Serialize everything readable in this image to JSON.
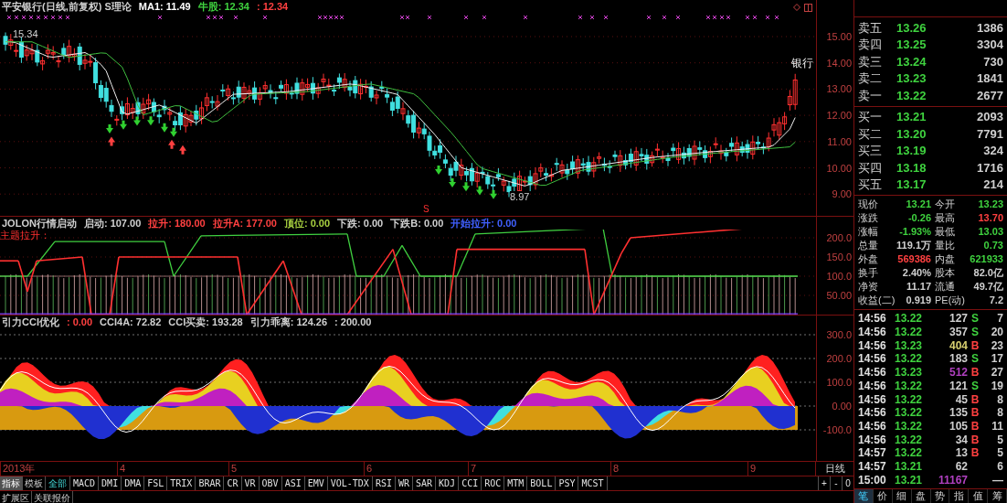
{
  "price_panel": {
    "header": [
      {
        "text": "平安银行(日线,前复权) S理论",
        "color": "#d0d0d0"
      },
      {
        "text": "MA1: 11.49",
        "color": "#ffffff"
      },
      {
        "text": "牛股: 12.34",
        "color": "#3fd23f"
      },
      {
        "text": ": 12.34",
        "color": "#ff4040"
      }
    ],
    "high_label": "15.34",
    "low_label": "8.97",
    "stock_label": "银行",
    "signal_mark": "S",
    "yticks": [
      "15.00",
      "14.00",
      "13.00",
      "12.00",
      "11.00",
      "10.00",
      "9.00"
    ]
  },
  "indicator_1": {
    "header": [
      {
        "text": "JOLON行情启动",
        "color": "#d0d0d0"
      },
      {
        "text": "启动: 107.00",
        "color": "#d0d0d0"
      },
      {
        "text": "拉升: 180.00",
        "color": "#ff4040"
      },
      {
        "text": "拉升A: 177.00",
        "color": "#ff4040"
      },
      {
        "text": "顶位: 0.00",
        "color": "#a8d040"
      },
      {
        "text": "下跌: 0.00",
        "color": "#d0d0d0"
      },
      {
        "text": "下跌B: 0.00",
        "color": "#d0d0d0"
      },
      {
        "text": "开始拉升: 0.00",
        "color": "#4060ff"
      }
    ],
    "sublabel": "主题拉升：",
    "yticks": [
      "200.0",
      "150.0",
      "100.0",
      "50.00"
    ]
  },
  "indicator_2": {
    "header": [
      {
        "text": "引力CCI优化",
        "color": "#d0d0d0"
      },
      {
        "text": ": 0.00",
        "color": "#ff4040"
      },
      {
        "text": "CCI4A: 72.82",
        "color": "#d0d0d0"
      },
      {
        "text": "CCI买卖: 193.28",
        "color": "#d0d0d0"
      },
      {
        "text": "引力乖离: 124.26",
        "color": "#d0d0d0"
      },
      {
        "text": ": 200.00",
        "color": "#d0d0d0"
      }
    ],
    "yticks": [
      "300.0",
      "200.0",
      "100.0",
      "0.00",
      "-100.0"
    ]
  },
  "date_axis": {
    "labels": [
      "2013年",
      "4",
      "5",
      "6",
      "7",
      "8",
      "9"
    ],
    "period": "日线"
  },
  "panel_tabs": [
    {
      "label": "指标",
      "selected": true
    },
    {
      "label": "模板",
      "selected": false
    }
  ],
  "indicator_tabs": [
    {
      "label": "全部",
      "selected": true
    },
    {
      "label": "MACD",
      "selected": false
    },
    {
      "label": "DMI",
      "selected": false
    },
    {
      "label": "DMA",
      "selected": false
    },
    {
      "label": "FSL",
      "selected": false
    },
    {
      "label": "TRIX",
      "selected": false
    },
    {
      "label": "BRAR",
      "selected": false
    },
    {
      "label": "CR",
      "selected": false
    },
    {
      "label": "VR",
      "selected": false
    },
    {
      "label": "OBV",
      "selected": false
    },
    {
      "label": "ASI",
      "selected": false
    },
    {
      "label": "EMV",
      "selected": false
    },
    {
      "label": "VOL-TDX",
      "selected": false
    },
    {
      "label": "RSI",
      "selected": false
    },
    {
      "label": "WR",
      "selected": false
    },
    {
      "label": "SAR",
      "selected": false
    },
    {
      "label": "KDJ",
      "selected": false
    },
    {
      "label": "CCI",
      "selected": false
    },
    {
      "label": "ROC",
      "selected": false
    },
    {
      "label": "MTM",
      "selected": false
    },
    {
      "label": "BOLL",
      "selected": false
    },
    {
      "label": "PSY",
      "selected": false
    },
    {
      "label": "MCST",
      "selected": false
    }
  ],
  "zoom_buttons": [
    "+",
    "-",
    "0"
  ],
  "bottom_tabs": [
    "扩展区",
    "关联报价"
  ],
  "quote": {
    "sell": [
      {
        "label": "卖五",
        "price": "13.26",
        "volume": "1386"
      },
      {
        "label": "卖四",
        "price": "13.25",
        "volume": "3304"
      },
      {
        "label": "卖三",
        "price": "13.24",
        "volume": "730"
      },
      {
        "label": "卖二",
        "price": "13.23",
        "volume": "1841"
      },
      {
        "label": "卖一",
        "price": "13.22",
        "volume": "2677"
      }
    ],
    "buy": [
      {
        "label": "买一",
        "price": "13.21",
        "volume": "2093"
      },
      {
        "label": "买二",
        "price": "13.20",
        "volume": "7791"
      },
      {
        "label": "买三",
        "price": "13.19",
        "volume": "324"
      },
      {
        "label": "买四",
        "price": "13.18",
        "volume": "1716"
      },
      {
        "label": "买五",
        "price": "13.17",
        "volume": "214"
      }
    ],
    "stats": [
      {
        "label": "现价",
        "value": "13.21",
        "color": "#3fd23f"
      },
      {
        "label": "今开",
        "value": "13.23",
        "color": "#3fd23f"
      },
      {
        "label": "涨跌",
        "value": "-0.26",
        "color": "#3fd23f"
      },
      {
        "label": "最高",
        "value": "13.70",
        "color": "#ff4040"
      },
      {
        "label": "涨幅",
        "value": "-1.93%",
        "color": "#3fd23f"
      },
      {
        "label": "最低",
        "value": "13.03",
        "color": "#3fd23f"
      },
      {
        "label": "总量",
        "value": "119.1万",
        "color": "#d0d0d0"
      },
      {
        "label": "量比",
        "value": "0.73",
        "color": "#3fd23f"
      },
      {
        "label": "外盘",
        "value": "569386",
        "color": "#ff4040"
      },
      {
        "label": "内盘",
        "value": "621933",
        "color": "#3fd23f"
      },
      {
        "label": "换手",
        "value": "2.40%",
        "color": "#d0d0d0"
      },
      {
        "label": "股本",
        "value": "82.0亿",
        "color": "#d0d0d0"
      },
      {
        "label": "净资",
        "value": "11.17",
        "color": "#d0d0d0"
      },
      {
        "label": "流通",
        "value": "49.7亿",
        "color": "#d0d0d0"
      },
      {
        "label": "收益(二)",
        "value": "0.919",
        "color": "#d0d0d0"
      },
      {
        "label": "PE(动)",
        "value": "7.2",
        "color": "#d0d0d0"
      }
    ],
    "trades": [
      {
        "time": "14:56",
        "price": "13.22",
        "volume": "127",
        "color": "#d0d0d0",
        "side": "S",
        "kind": "sell",
        "count": "7"
      },
      {
        "time": "14:56",
        "price": "13.22",
        "volume": "357",
        "color": "#d0d0d0",
        "side": "S",
        "kind": "sell",
        "count": "20"
      },
      {
        "time": "14:56",
        "price": "13.23",
        "volume": "404",
        "color": "#d8d070",
        "side": "B",
        "kind": "buy",
        "count": "23"
      },
      {
        "time": "14:56",
        "price": "13.22",
        "volume": "183",
        "color": "#d0d0d0",
        "side": "S",
        "kind": "sell",
        "count": "17"
      },
      {
        "time": "14:56",
        "price": "13.23",
        "volume": "512",
        "color": "#b040c0",
        "side": "B",
        "kind": "buy",
        "count": "27"
      },
      {
        "time": "14:56",
        "price": "13.22",
        "volume": "121",
        "color": "#d0d0d0",
        "side": "S",
        "kind": "sell",
        "count": "19"
      },
      {
        "time": "14:56",
        "price": "13.22",
        "volume": "45",
        "color": "#d0d0d0",
        "side": "B",
        "kind": "buy",
        "count": "8"
      },
      {
        "time": "14:56",
        "price": "13.22",
        "volume": "135",
        "color": "#d0d0d0",
        "side": "B",
        "kind": "buy",
        "count": "8"
      },
      {
        "time": "14:56",
        "price": "13.22",
        "volume": "105",
        "color": "#d0d0d0",
        "side": "B",
        "kind": "buy",
        "count": "11"
      },
      {
        "time": "14:56",
        "price": "13.22",
        "volume": "34",
        "color": "#d0d0d0",
        "side": "B",
        "kind": "buy",
        "count": "5"
      },
      {
        "time": "14:57",
        "price": "13.22",
        "volume": "13",
        "color": "#d0d0d0",
        "side": "B",
        "kind": "buy",
        "count": "5"
      },
      {
        "time": "14:57",
        "price": "13.21",
        "volume": "62",
        "color": "#d0d0d0",
        "count": "6"
      },
      {
        "time": "15:00",
        "price": "13.21",
        "volume": "11167",
        "color": "#b040c0",
        "count": "—"
      }
    ],
    "tabs": [
      {
        "label": "笔",
        "selected": true
      },
      {
        "label": "价",
        "selected": false
      },
      {
        "label": "细",
        "selected": false
      },
      {
        "label": "盘",
        "selected": false
      },
      {
        "label": "势",
        "selected": false
      },
      {
        "label": "指",
        "selected": false
      },
      {
        "label": "值",
        "selected": false
      },
      {
        "label": "筹",
        "selected": false
      }
    ]
  }
}
